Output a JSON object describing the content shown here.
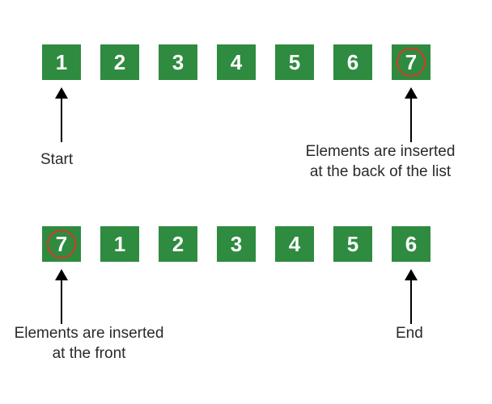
{
  "diagram": {
    "rows": [
      {
        "id": "top",
        "boxes": [
          "1",
          "2",
          "3",
          "4",
          "5",
          "6",
          "7"
        ],
        "circled_index": 6,
        "annotations": [
          {
            "target_index": 0,
            "label": "Start"
          },
          {
            "target_index": 6,
            "label": "Elements are inserted\nat the back of the list"
          }
        ]
      },
      {
        "id": "bottom",
        "boxes": [
          "7",
          "1",
          "2",
          "3",
          "4",
          "5",
          "6"
        ],
        "circled_index": 0,
        "annotations": [
          {
            "target_index": 0,
            "label": "Elements are inserted\nat the front"
          },
          {
            "target_index": 6,
            "label": "End"
          }
        ]
      }
    ],
    "colors": {
      "box_fill": "#2e8b3f",
      "box_text": "#ffffff",
      "circle": "#d43a2a",
      "arrow": "#000000",
      "label": "#2a2a2a"
    }
  }
}
